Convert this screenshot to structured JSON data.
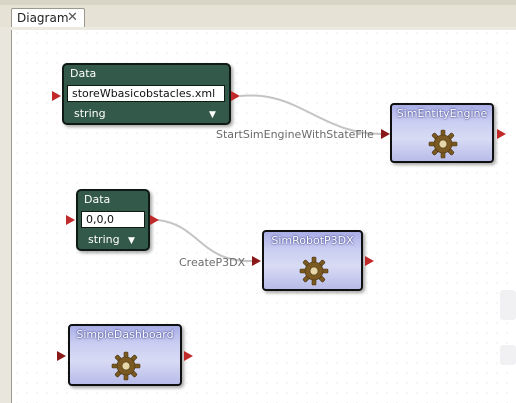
{
  "tab": {
    "label": "Diagram",
    "close": "✕"
  },
  "data_nodes": [
    {
      "title": "Data",
      "value": "storeWbasicobstacles.xml",
      "type": "string"
    },
    {
      "title": "Data",
      "value": "0,0,0",
      "type": "string"
    }
  ],
  "services": [
    {
      "name": "SimEntityEngine"
    },
    {
      "name": "SimRobotP3DX"
    },
    {
      "name": "SimpleDashboard"
    }
  ],
  "connections": [
    {
      "label": "StartSimEngineWithStateFile"
    },
    {
      "label": "CreateP3DX"
    }
  ],
  "colors": {
    "data_node_bg": "#33594a",
    "service_accent": "#a9aee6",
    "port": "#c02a2a",
    "wire": "#c4c4c4"
  },
  "icons": {
    "service_icon": "gear-icon",
    "dropdown_icon": "chevron-down-icon"
  }
}
